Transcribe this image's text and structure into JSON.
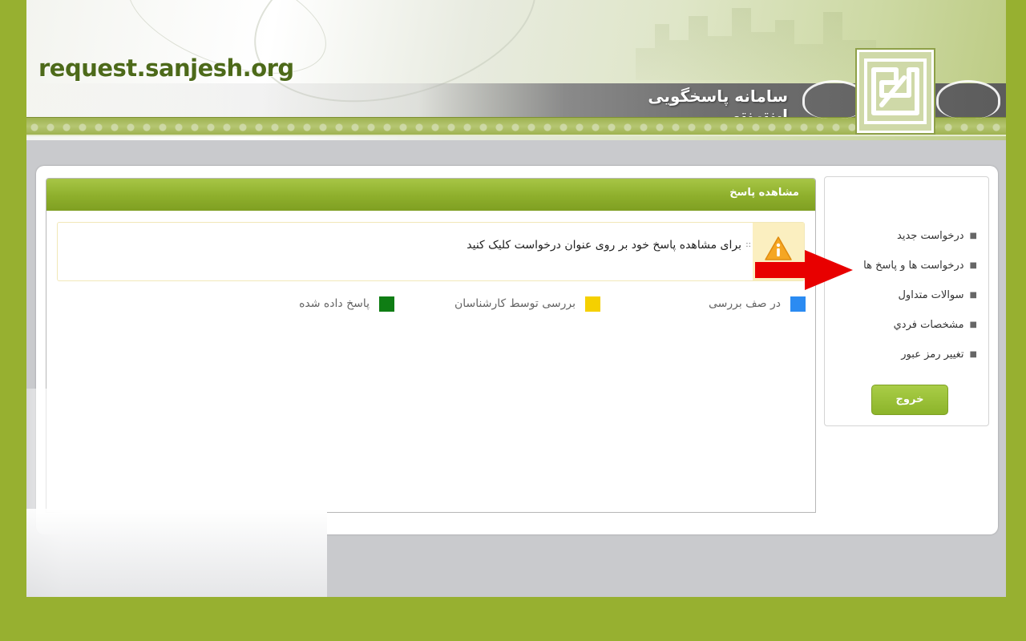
{
  "header": {
    "site_url": "request.sanjesh.org",
    "system_title": "سامانه پاسخگویی اینترنتی",
    "logo_icon": "sanjesh-logo"
  },
  "main": {
    "title": "مشاهده پاسخ",
    "notice": {
      "icon": "warning-info-icon",
      "dots": "::",
      "text": "برای مشاهده پاسخ خود بر روی عنوان درخواست کلیک کنید"
    },
    "legend": [
      {
        "label": "در صف بررسی",
        "color": "#2b8bf2"
      },
      {
        "label": "بررسی توسط کارشناسان",
        "color": "#f5d000"
      },
      {
        "label": "پاسخ داده شده",
        "color": "#0f7d14"
      }
    ]
  },
  "sidebar": {
    "items": [
      {
        "label": "درخواست جدید"
      },
      {
        "label": "درخواست ها و پاسخ ها"
      },
      {
        "label": "سوالات متداول"
      },
      {
        "label": "مشخصات فردي"
      },
      {
        "label": "تغيير رمز عبور"
      }
    ],
    "bullet": "■",
    "logout_label": "خروج"
  },
  "annotation": {
    "icon": "red-arrow-icon",
    "color": "#e80000"
  },
  "colors": {
    "page_background": "#97b030",
    "header_green": "#8eaf2c",
    "panel_gray": "#c9cacd"
  }
}
